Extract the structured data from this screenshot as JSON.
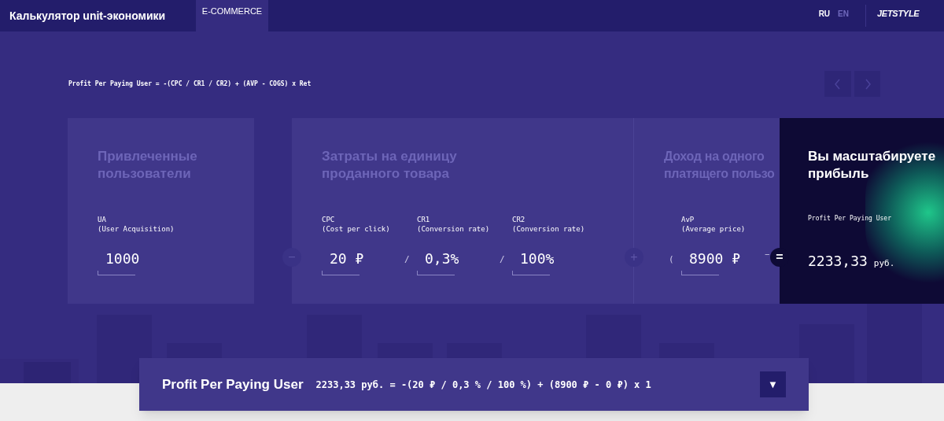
{
  "header": {
    "title": "Калькулятор unit-экономики",
    "tabs": [
      {
        "label": "E-COMMERCE",
        "selected": true
      }
    ],
    "languages": [
      {
        "label": "RU",
        "selected": true
      },
      {
        "label": "EN",
        "selected": false
      }
    ],
    "logo": "JETSTYLE"
  },
  "formula": "Profit Per Paying User = -(CPC / CR1 / CR2) + (AVP - COGS) x Ret",
  "cards": [
    {
      "title_lines": [
        "Привлеченные",
        "пользователи"
      ],
      "fields": [
        {
          "label": "UA",
          "hint": "(User Acquisition)",
          "value": "1000"
        }
      ]
    },
    {
      "operator": "−",
      "title_lines": [
        "Затраты на единицу",
        "проданного товара"
      ],
      "fields": [
        {
          "label": "CPC",
          "hint": "(Cost per click)",
          "value": "20 ₽"
        },
        {
          "sign": "/",
          "label": "CR1",
          "hint": "(Conversion rate)",
          "value": "0,3%"
        },
        {
          "sign": "/",
          "label": "CR2",
          "hint": "(Conversion rate)",
          "value": "100%"
        }
      ]
    },
    {
      "operator": "+",
      "title_lines": [
        "Доход на одного",
        "платящего пользо"
      ],
      "fields": [
        {
          "sign": "(",
          "label": "AvP",
          "hint": "(Average price)",
          "value": "8900 ₽"
        }
      ],
      "trailing_sign": "−"
    }
  ],
  "result": {
    "operator": "=",
    "title_lines": [
      "Вы масштабируете",
      "прибыль"
    ],
    "label": "Profit Per Paying User",
    "value": "2233,33",
    "unit": "руб."
  },
  "summary": {
    "title": "Profit Per Paying User",
    "expression": "2233,33 руб. = -(20 ₽ / 0,3 % / 100 %) + (8900 ₽ - 0 ₽) x 1",
    "toggle": "▼"
  }
}
